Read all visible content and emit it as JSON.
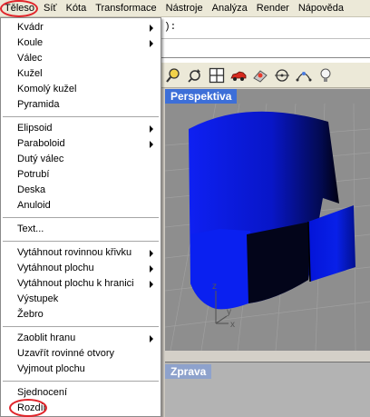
{
  "menubar": {
    "items": [
      "Těleso",
      "Síť",
      "Kóta",
      "Transformace",
      "Nástroje",
      "Analýza",
      "Render",
      "Nápověda"
    ]
  },
  "command": {
    "line1_text": "):"
  },
  "viewports": {
    "perspective_title": "Perspektiva",
    "right_title": "Zprava",
    "axis_x": "x",
    "axis_y": "y",
    "axis_z": "z"
  },
  "menu": {
    "groups": [
      [
        {
          "label": "Kvádr",
          "submenu": true
        },
        {
          "label": "Koule",
          "submenu": true
        },
        {
          "label": "Válec",
          "submenu": false
        },
        {
          "label": "Kužel",
          "submenu": false
        },
        {
          "label": "Komolý kužel",
          "submenu": false
        },
        {
          "label": "Pyramida",
          "submenu": false
        }
      ],
      [
        {
          "label": "Elipsoid",
          "submenu": true
        },
        {
          "label": "Paraboloid",
          "submenu": true
        },
        {
          "label": "Dutý válec",
          "submenu": false
        },
        {
          "label": "Potrubí",
          "submenu": false
        },
        {
          "label": "Deska",
          "submenu": false
        },
        {
          "label": "Anuloid",
          "submenu": false
        }
      ],
      [
        {
          "label": "Text...",
          "submenu": false
        }
      ],
      [
        {
          "label": "Vytáhnout rovinnou křivku",
          "submenu": true
        },
        {
          "label": "Vytáhnout plochu",
          "submenu": true
        },
        {
          "label": "Vytáhnout plochu k hranici",
          "submenu": true
        },
        {
          "label": "Výstupek",
          "submenu": false
        },
        {
          "label": "Žebro",
          "submenu": false
        }
      ],
      [
        {
          "label": "Zaoblit hranu",
          "submenu": true
        },
        {
          "label": "Uzavřít rovinné otvory",
          "submenu": false
        },
        {
          "label": "Vyjmout plochu",
          "submenu": false
        }
      ],
      [
        {
          "label": "Sjednocení",
          "submenu": false
        },
        {
          "label": "Rozdíl",
          "submenu": false
        }
      ]
    ]
  },
  "colors": {
    "highlight_circle": "#e0242a",
    "solid_blue": "#0a1be0",
    "viewport_title_active": "#3d6fd8",
    "viewport_title_inactive": "#8ea2cc"
  },
  "toolbar": {
    "icons": [
      "zoom-icon",
      "rotate-icon",
      "four-viewports-icon",
      "car-render-icon",
      "shaded-grid-icon",
      "target-point-icon",
      "curve-point-icon",
      "light-bulb-icon"
    ]
  }
}
